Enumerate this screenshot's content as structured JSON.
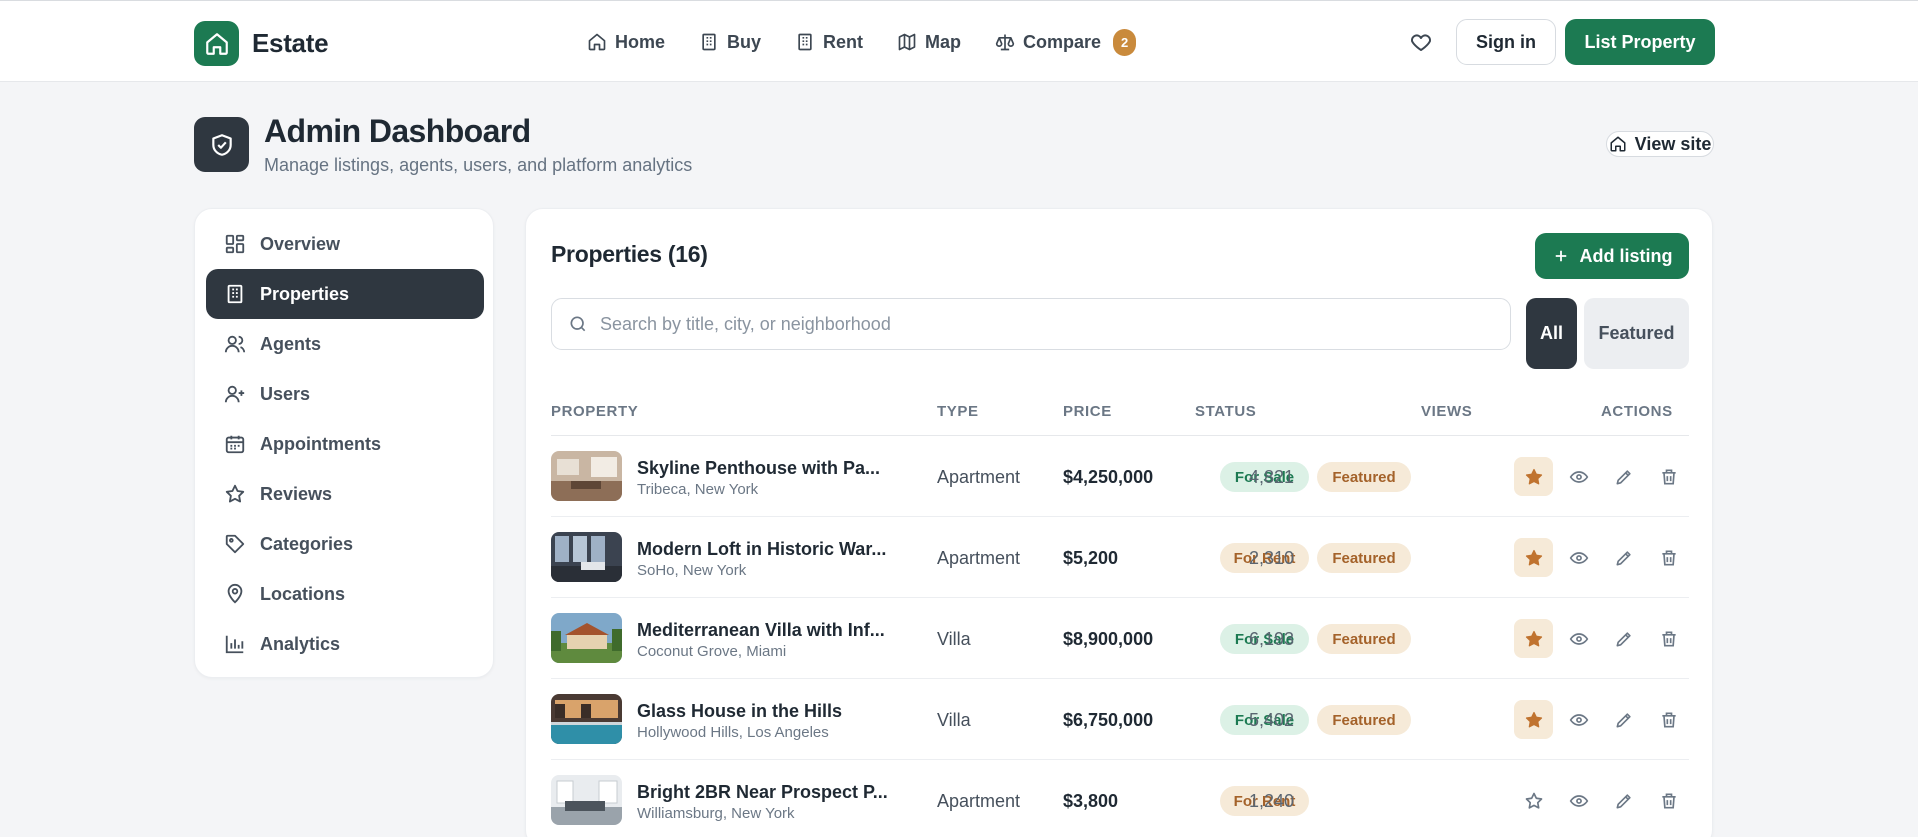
{
  "brand": {
    "name": "Estate"
  },
  "nav": {
    "items": [
      {
        "label": "Home",
        "icon": "home-icon"
      },
      {
        "label": "Buy",
        "icon": "building-icon"
      },
      {
        "label": "Rent",
        "icon": "building-icon"
      },
      {
        "label": "Map",
        "icon": "map-icon"
      },
      {
        "label": "Compare",
        "icon": "scale-icon"
      }
    ],
    "compare_count": "2",
    "sign_in": "Sign in",
    "list_property": "List Property"
  },
  "header": {
    "title": "Admin Dashboard",
    "subtitle": "Manage listings, agents, users, and platform analytics",
    "view_site": "View site"
  },
  "sidebar": {
    "items": [
      {
        "label": "Overview",
        "icon": "grid-icon"
      },
      {
        "label": "Properties",
        "icon": "building-icon",
        "active": true
      },
      {
        "label": "Agents",
        "icon": "users-icon"
      },
      {
        "label": "Users",
        "icon": "user-plus-icon"
      },
      {
        "label": "Appointments",
        "icon": "calendar-icon"
      },
      {
        "label": "Reviews",
        "icon": "star-icon"
      },
      {
        "label": "Categories",
        "icon": "tag-icon"
      },
      {
        "label": "Locations",
        "icon": "pin-icon"
      },
      {
        "label": "Analytics",
        "icon": "bar-chart-icon"
      }
    ]
  },
  "main": {
    "title": "Properties (16)",
    "add_listing": "Add listing",
    "search_placeholder": "Search by title, city, or neighborhood",
    "search_value": "",
    "filters": {
      "all": "All",
      "featured": "Featured"
    },
    "columns": {
      "property": "PROPERTY",
      "type": "TYPE",
      "price": "PRICE",
      "status": "STATUS",
      "views": "VIEWS",
      "actions": "ACTIONS"
    },
    "rows": [
      {
        "title": "Skyline Penthouse with Pa...",
        "location": "Tribeca, New York",
        "type": "Apartment",
        "price": "$4,250,000",
        "status": "For Sale",
        "status_kind": "sale",
        "featured": "Featured",
        "views": "4,821",
        "starred": true
      },
      {
        "title": "Modern Loft in Historic War...",
        "location": "SoHo, New York",
        "type": "Apartment",
        "price": "$5,200",
        "status": "For Rent",
        "status_kind": "rent",
        "featured": "Featured",
        "views": "2,310",
        "starred": true
      },
      {
        "title": "Mediterranean Villa with Inf...",
        "location": "Coconut Grove, Miami",
        "type": "Villa",
        "price": "$8,900,000",
        "status": "For Sale",
        "status_kind": "sale",
        "featured": "Featured",
        "views": "6,193",
        "starred": true
      },
      {
        "title": "Glass House in the Hills",
        "location": "Hollywood Hills, Los Angeles",
        "type": "Villa",
        "price": "$6,750,000",
        "status": "For Sale",
        "status_kind": "sale",
        "featured": "Featured",
        "views": "5,402",
        "starred": true
      },
      {
        "title": "Bright 2BR Near Prospect P...",
        "location": "Williamsburg, New York",
        "type": "Apartment",
        "price": "$3,800",
        "status": "For Rent",
        "status_kind": "rent",
        "featured": "",
        "views": "1,240",
        "starred": false
      }
    ]
  },
  "colors": {
    "brand_green": "#1c7a52",
    "dark": "#2f3740",
    "accent_orange": "#c98a3c",
    "sale_bg": "#dcf1e6",
    "rent_bg": "#f6ead8"
  }
}
